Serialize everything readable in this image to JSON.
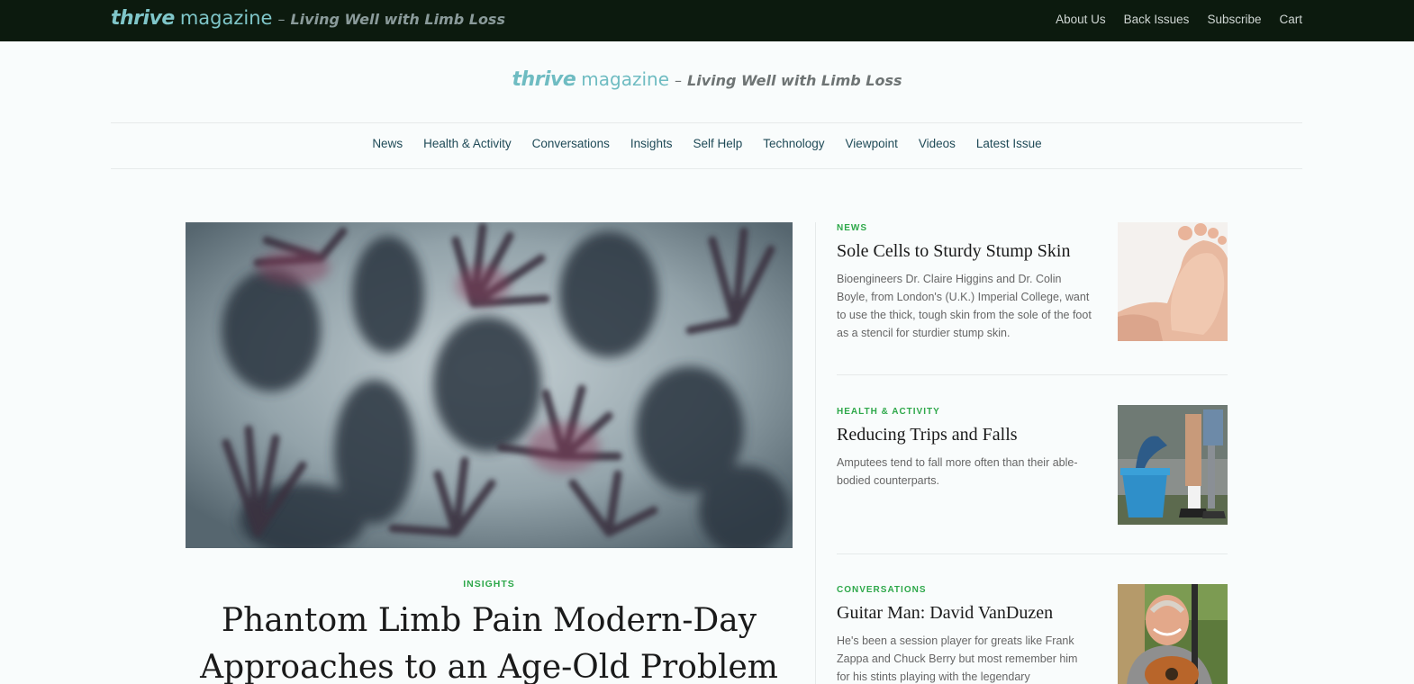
{
  "topbar": {
    "logo_thrive": "thrive",
    "logo_magazine": "magazine",
    "logo_dash": "–",
    "logo_tagline": "Living Well with Limb Loss",
    "links": [
      "About Us",
      "Back Issues",
      "Subscribe",
      "Cart"
    ]
  },
  "masthead": {
    "logo_thrive": "thrive",
    "logo_magazine": "magazine",
    "logo_dash": "–",
    "logo_tagline": "Living Well with Limb Loss"
  },
  "nav": {
    "items": [
      "News",
      "Health & Activity",
      "Conversations",
      "Insights",
      "Self Help",
      "Technology",
      "Viewpoint",
      "Videos",
      "Latest Issue"
    ]
  },
  "feature": {
    "category": "INSIGHTS",
    "title": "Phantom Limb Pain Modern-Day Approaches to an Age-Old Problem"
  },
  "articles": [
    {
      "category": "NEWS",
      "title": "Sole Cells to Sturdy Stump Skin",
      "excerpt": "Bioengineers Dr. Claire Higgins and Dr. Colin Boyle, from London's (U.K.) Imperial College, want to use the thick, tough skin from the sole of the foot as a stencil for sturdier stump skin."
    },
    {
      "category": "HEALTH & ACTIVITY",
      "title": "Reducing Trips and Falls",
      "excerpt": "Amputees tend to fall more often than their able-bodied counterparts."
    },
    {
      "category": "CONVERSATIONS",
      "title": "Guitar Man: David VanDuzen",
      "excerpt": "He's been a session player for greats like Frank Zappa and Chuck Berry but most remember him for his stints playing with the legendary"
    }
  ],
  "colors": {
    "topbar_bg": "#0c1a0e",
    "logo_teal": "#7fc6c9",
    "category_green": "#2ea84a",
    "nav_text": "#1f4a57"
  }
}
